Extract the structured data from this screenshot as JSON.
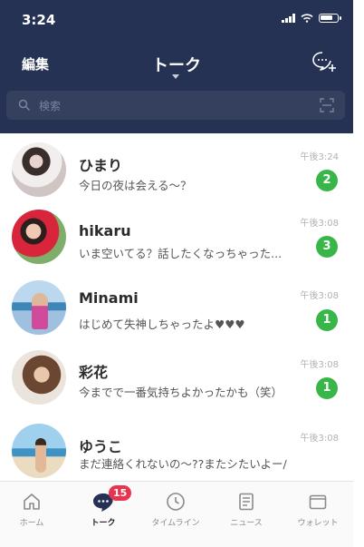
{
  "status_bar": {
    "time": "3:24"
  },
  "header": {
    "edit_label": "編集",
    "title": "トーク"
  },
  "search": {
    "placeholder": "検索"
  },
  "chats": [
    {
      "name": "ひまり",
      "preview": "今日の夜は会える〜？",
      "time": "午後3:24",
      "unread": "2"
    },
    {
      "name": "hikaru",
      "preview": "いま空いてる？話したくなっちゃった...",
      "time": "午後3:08",
      "unread": "3"
    },
    {
      "name": "Minami",
      "preview": "はじめて失神しちゃったよ♥♥♥",
      "time": "午後3:08",
      "unread": "1"
    },
    {
      "name": "彩花",
      "preview": "今までで一番気持ちよかったかも（笑）",
      "time": "午後3:08",
      "unread": "1"
    },
    {
      "name": "ゆうこ",
      "preview": "まだ連絡くれないの〜??またシたいよー///",
      "time": "午後3:08",
      "unread": ""
    }
  ],
  "tabbar": {
    "tabs": [
      {
        "label": "ホーム",
        "icon": "home-icon"
      },
      {
        "label": "トーク",
        "icon": "chat-icon",
        "badge": "15"
      },
      {
        "label": "タイムライン",
        "icon": "clock-icon"
      },
      {
        "label": "ニュース",
        "icon": "news-icon"
      },
      {
        "label": "ウォレット",
        "icon": "wallet-icon"
      }
    ]
  },
  "colors": {
    "header_bg": "#253253",
    "badge_green": "#39b649",
    "badge_red": "#e8344e"
  }
}
